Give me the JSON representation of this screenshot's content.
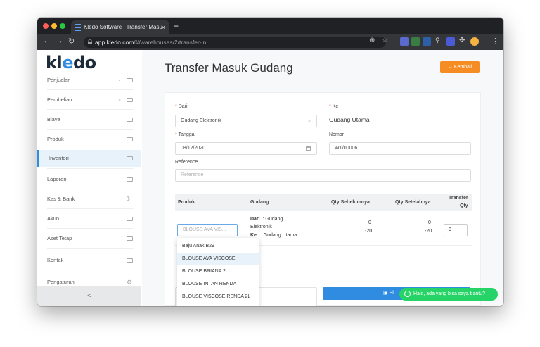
{
  "browser": {
    "tab_title": "Kledo Software | Transfer Masu",
    "tab_close": "×",
    "new_tab": "+",
    "url_host": "app.kledo.com",
    "url_path": "/#/warehouses/2/transfer-in",
    "colors": {
      "traffic_red": "#ff5f57",
      "traffic_yellow": "#febc2e",
      "traffic_green": "#28c840"
    }
  },
  "sidebar": {
    "logo_prefix": "kl",
    "logo_e": "e",
    "logo_suffix": "do",
    "items": [
      {
        "label": "Penjualan"
      },
      {
        "label": "Pembelian"
      },
      {
        "label": "Biaya"
      },
      {
        "label": "Produk"
      },
      {
        "label": "Inventori"
      },
      {
        "label": "Laporan"
      },
      {
        "label": "Kas & Bank"
      },
      {
        "label": "Akun"
      },
      {
        "label": "Aset Tetap"
      },
      {
        "label": "Kontak"
      },
      {
        "label": "Pengaturan"
      }
    ],
    "collapse": "<",
    "accent": "#2f8ce0"
  },
  "page": {
    "title": "Transfer Masuk Gudang",
    "back_label": "← Kembali",
    "from_label": "Dari",
    "from_value": "Gudang Elektronik",
    "to_label": "Ke",
    "to_value": "Gudang Utama",
    "date_label": "Tanggal",
    "date_value": "08/12/2020",
    "number_label": "Nomor",
    "number_value": "WT/00006",
    "reference_label": "Reference",
    "reference_placeholder": "Reference",
    "required_mark": "*"
  },
  "table": {
    "headers": [
      "Produk",
      "Gudang",
      "Qty Sebelumnya",
      "Qty Setelahnya",
      "Transfer",
      "Qty"
    ],
    "row": {
      "product_placeholder": "BLOUSE AVA VIS...",
      "from_prefix": "Dari",
      "from_value": ": Gudang",
      "from_cont": "Elektronik",
      "to_prefix": "Ke",
      "to_value": ": Gudang Utama",
      "qty_before_from": "0",
      "qty_before_to": "-20",
      "qty_after_from": "0",
      "qty_after_to": "-20",
      "transfer_qty": "0"
    }
  },
  "dropdown": {
    "options": [
      "Baju Anak B29",
      "BLOUSE AVA VISCOSE",
      "BLOUSE BRIANA 2",
      "BLOUSE INTAN RENDA",
      "BLOUSE VISCOSE RENDA 2L"
    ],
    "selected": "BLOUSE AVA VISCOSE"
  },
  "actions": {
    "save_label": "Si"
  },
  "chat": {
    "label": "Halo, ada yang bisa saya bantu?"
  }
}
